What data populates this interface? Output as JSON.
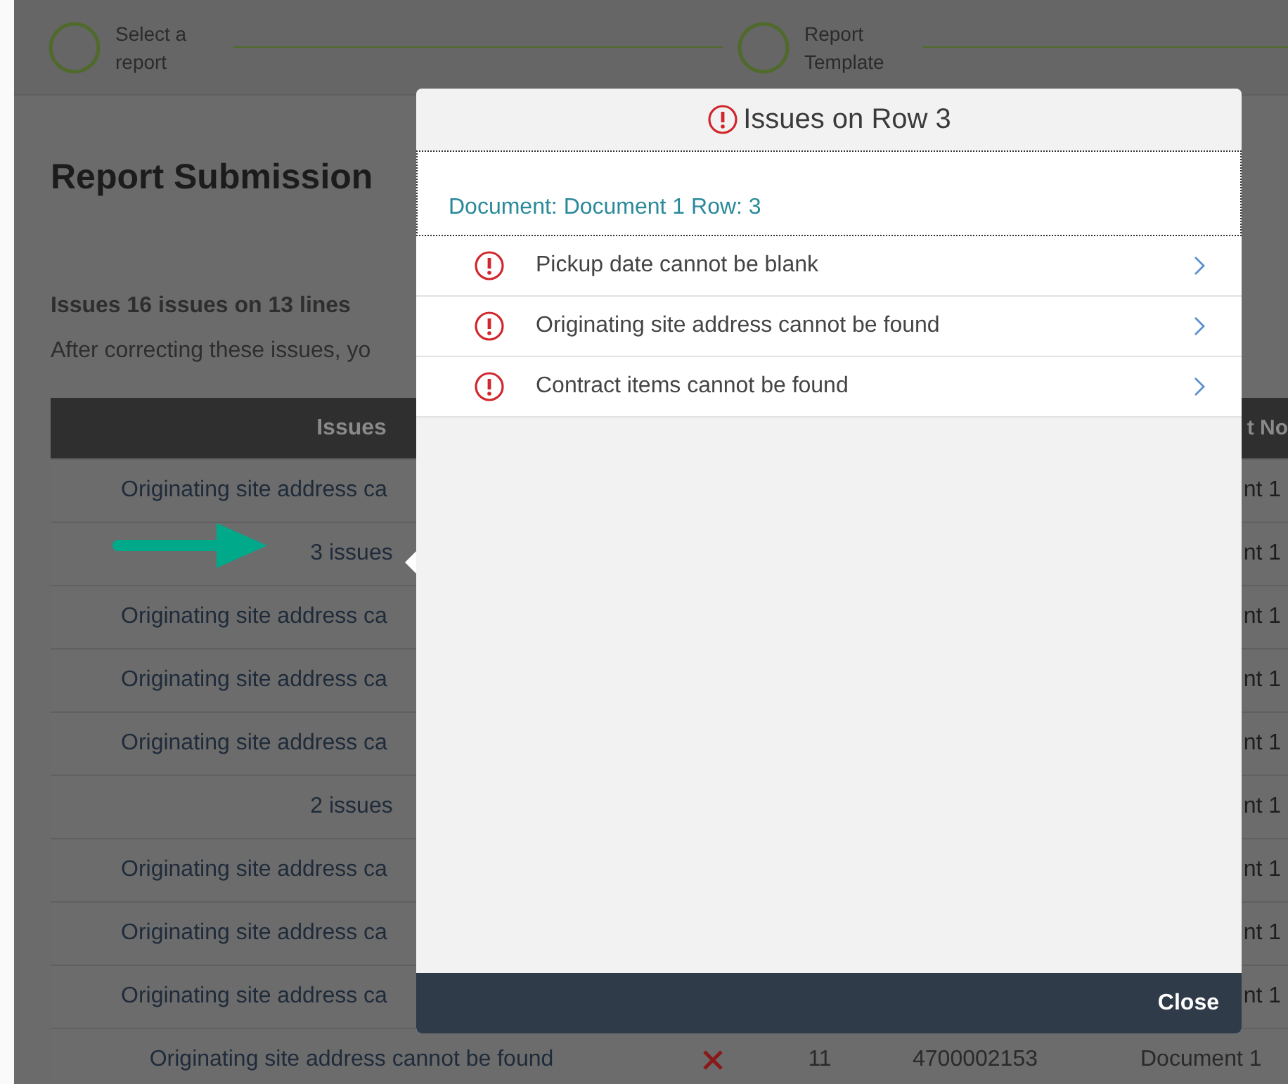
{
  "stepper": [
    {
      "label": "Select a report"
    },
    {
      "label": "Report Template"
    }
  ],
  "page": {
    "title": "Report Submission",
    "issues_summary": "Issues 16 issues on 13 lines",
    "note": "After correcting these issues, yo"
  },
  "table": {
    "columns": [
      "Issues",
      "t No"
    ],
    "rows": [
      {
        "kind": "text",
        "issue": "Originating site address ca",
        "document": "nt 1"
      },
      {
        "kind": "count",
        "issue": "3 issues",
        "document": "nt 1"
      },
      {
        "kind": "text",
        "issue": "Originating site address ca",
        "document": "nt 1"
      },
      {
        "kind": "text",
        "issue": "Originating site address ca",
        "document": "nt 1"
      },
      {
        "kind": "text",
        "issue": "Originating site address ca",
        "document": "nt 1"
      },
      {
        "kind": "count",
        "issue": "2 issues",
        "document": "nt 1"
      },
      {
        "kind": "text",
        "issue": "Originating site address ca",
        "document": "nt 1"
      },
      {
        "kind": "text",
        "issue": "Originating site address ca",
        "document": "nt 1"
      },
      {
        "kind": "text",
        "issue": "Originating site address ca",
        "document": "nt 1"
      }
    ],
    "last_row": {
      "issue": "Originating site address cannot be found",
      "line": "11",
      "number": "4700002153",
      "document": "Document 1"
    }
  },
  "dialog": {
    "title": "Issues on Row 3",
    "context": "Document: Document 1 Row: 3",
    "issues": [
      "Pickup date cannot be blank",
      "Originating site address cannot be found",
      "Contract items cannot be found"
    ],
    "close": "Close"
  }
}
